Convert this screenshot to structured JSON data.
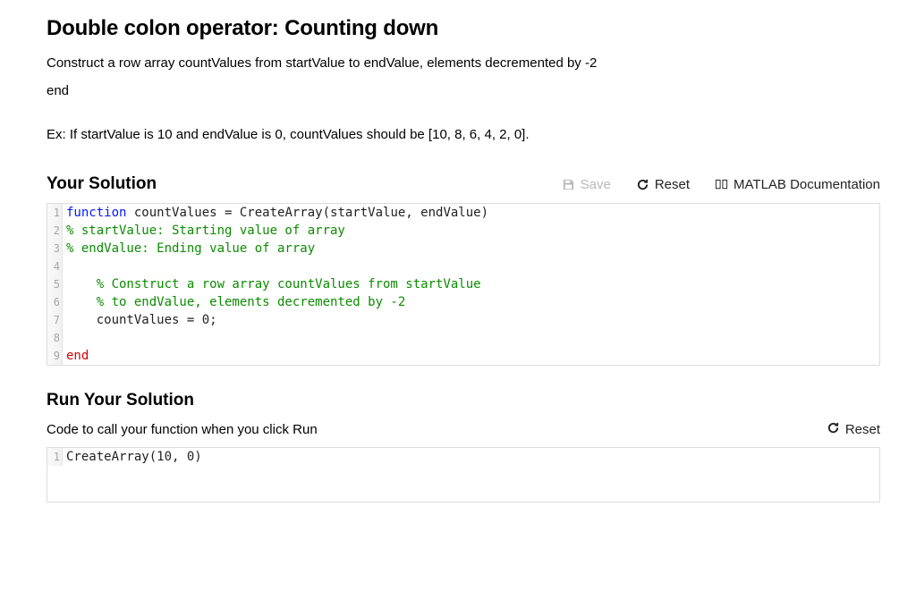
{
  "header": {
    "title": "Double colon operator: Counting down",
    "prompt_line": "Construct a row array countValues from startValue to endValue, elements decremented by -2",
    "end_line": "end",
    "example_line": "Ex: If startValue is 10 and endValue is 0, countValues should be [10, 8, 6, 4, 2, 0]."
  },
  "solution": {
    "heading": "Your Solution",
    "actions": {
      "save": "Save",
      "reset": "Reset",
      "doc": "MATLAB Documentation"
    },
    "code": {
      "line1": {
        "kw": "function",
        "rest": " countValues = CreateArray(startValue, endValue)"
      },
      "line2": "% startValue: Starting value of array",
      "line3": "% endValue: Ending value of array",
      "line4": "",
      "line5": "    % Construct a row array countValues from startValue",
      "line6": "    % to endValue, elements decremented by -2",
      "line7": "    countValues = 0;",
      "line8": "",
      "line9": "end"
    }
  },
  "run": {
    "heading": "Run Your Solution",
    "subtitle": "Code to call your function when you click Run",
    "reset": "Reset",
    "code": {
      "line1": "CreateArray(10, 0)"
    }
  },
  "line_numbers": {
    "n1": "1",
    "n2": "2",
    "n3": "3",
    "n4": "4",
    "n5": "5",
    "n6": "6",
    "n7": "7",
    "n8": "8",
    "n9": "9"
  }
}
